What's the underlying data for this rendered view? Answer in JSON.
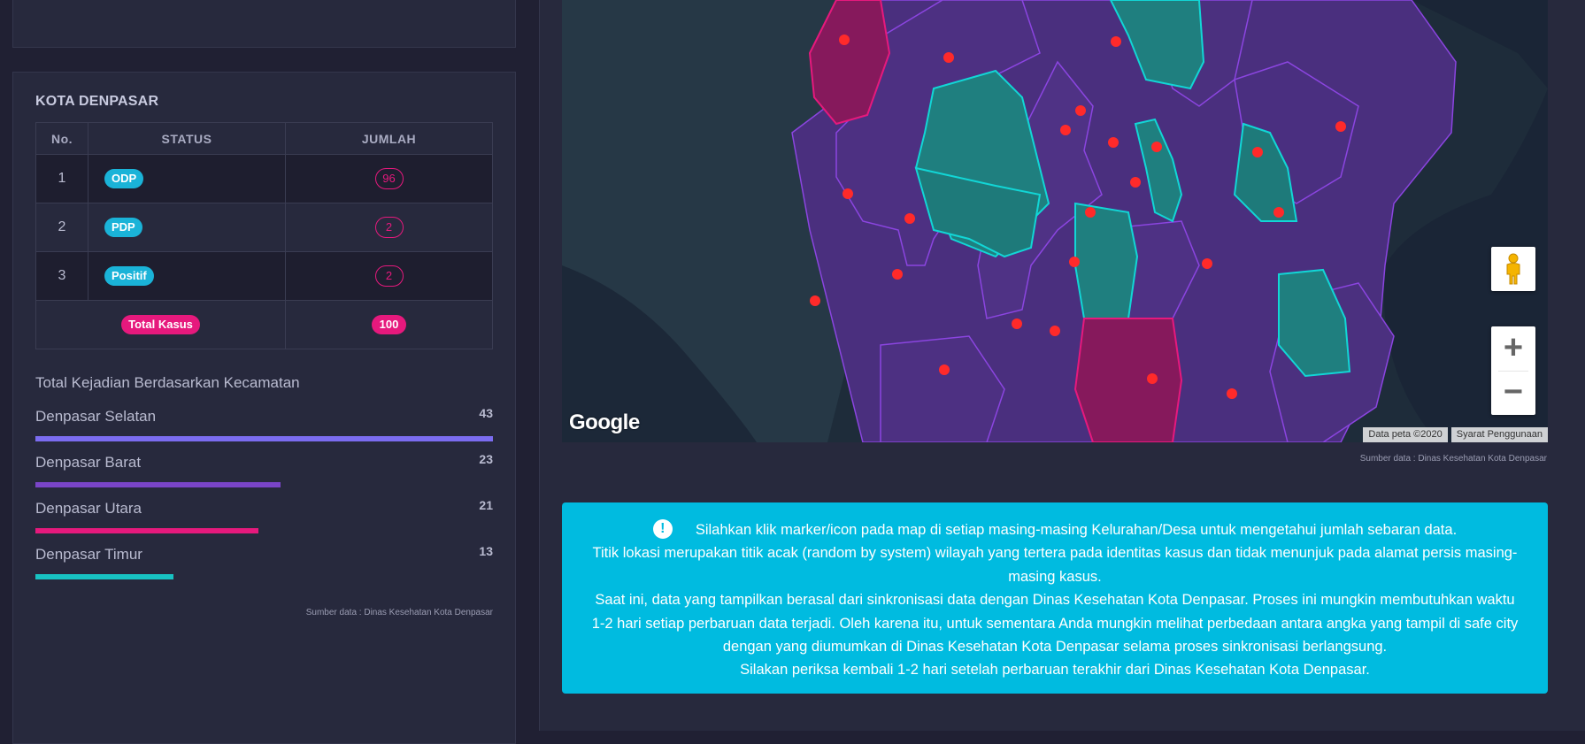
{
  "city_title": "KOTA DENPASAR",
  "table": {
    "headers": [
      "No.",
      "STATUS",
      "JUMLAH"
    ],
    "rows": [
      {
        "no": "1",
        "status": "ODP",
        "jumlah": "96"
      },
      {
        "no": "2",
        "status": "PDP",
        "jumlah": "2"
      },
      {
        "no": "3",
        "status": "Positif",
        "jumlah": "2"
      }
    ],
    "total_label": "Total Kasus",
    "total_value": "100"
  },
  "kecamatan": {
    "title": "Total Kejadian Berdasarkan Kecamatan",
    "items": [
      {
        "name": "Denpasar Selatan",
        "value": 43,
        "color": "#7b6cf0"
      },
      {
        "name": "Denpasar Barat",
        "value": 23,
        "color": "#7a45c8"
      },
      {
        "name": "Denpasar Utara",
        "value": 21,
        "color": "#e6197d"
      },
      {
        "name": "Denpasar Timur",
        "value": 13,
        "color": "#18c2c2"
      }
    ],
    "source": "Sumber data : Dinas Kesehatan Kota Denpasar"
  },
  "map": {
    "logo": "Google",
    "attribution_data": "Data peta ©2020",
    "attribution_terms": "Syarat Penggunaan",
    "zoom_in": "+",
    "zoom_out": "−",
    "source": "Sumber data : Dinas Kesehatan Kota Denpasar",
    "colors": {
      "default": "#4a2f7e",
      "border": "#8b45e0",
      "teal": "#1f7f7f",
      "pink": "#86195c",
      "marker": "#ff2a2a"
    }
  },
  "info": {
    "line1": "Silahkan klik marker/icon pada map di setiap masing-masing Kelurahan/Desa untuk mengetahui jumlah sebaran data.",
    "line2": "Titik lokasi merupakan titik acak (random by system) wilayah yang tertera pada identitas kasus dan tidak menunjuk pada alamat persis masing-masing kasus.",
    "line3": "Saat ini, data yang tampilkan berasal dari sinkronisasi data dengan Dinas Kesehatan Kota Denpasar. Proses ini mungkin membutuhkan waktu 1-2 hari setiap perbaruan data terjadi. Oleh karena itu, untuk sementara Anda mungkin melihat perbedaan antara angka yang tampil di safe city dengan yang diumumkan di Dinas Kesehatan Kota Denpasar selama proses sinkronisasi berlangsung.",
    "line4": "Silakan periksa kembali 1-2 hari setelah perbaruan terakhir dari Dinas Kesehatan Kota Denpasar."
  }
}
